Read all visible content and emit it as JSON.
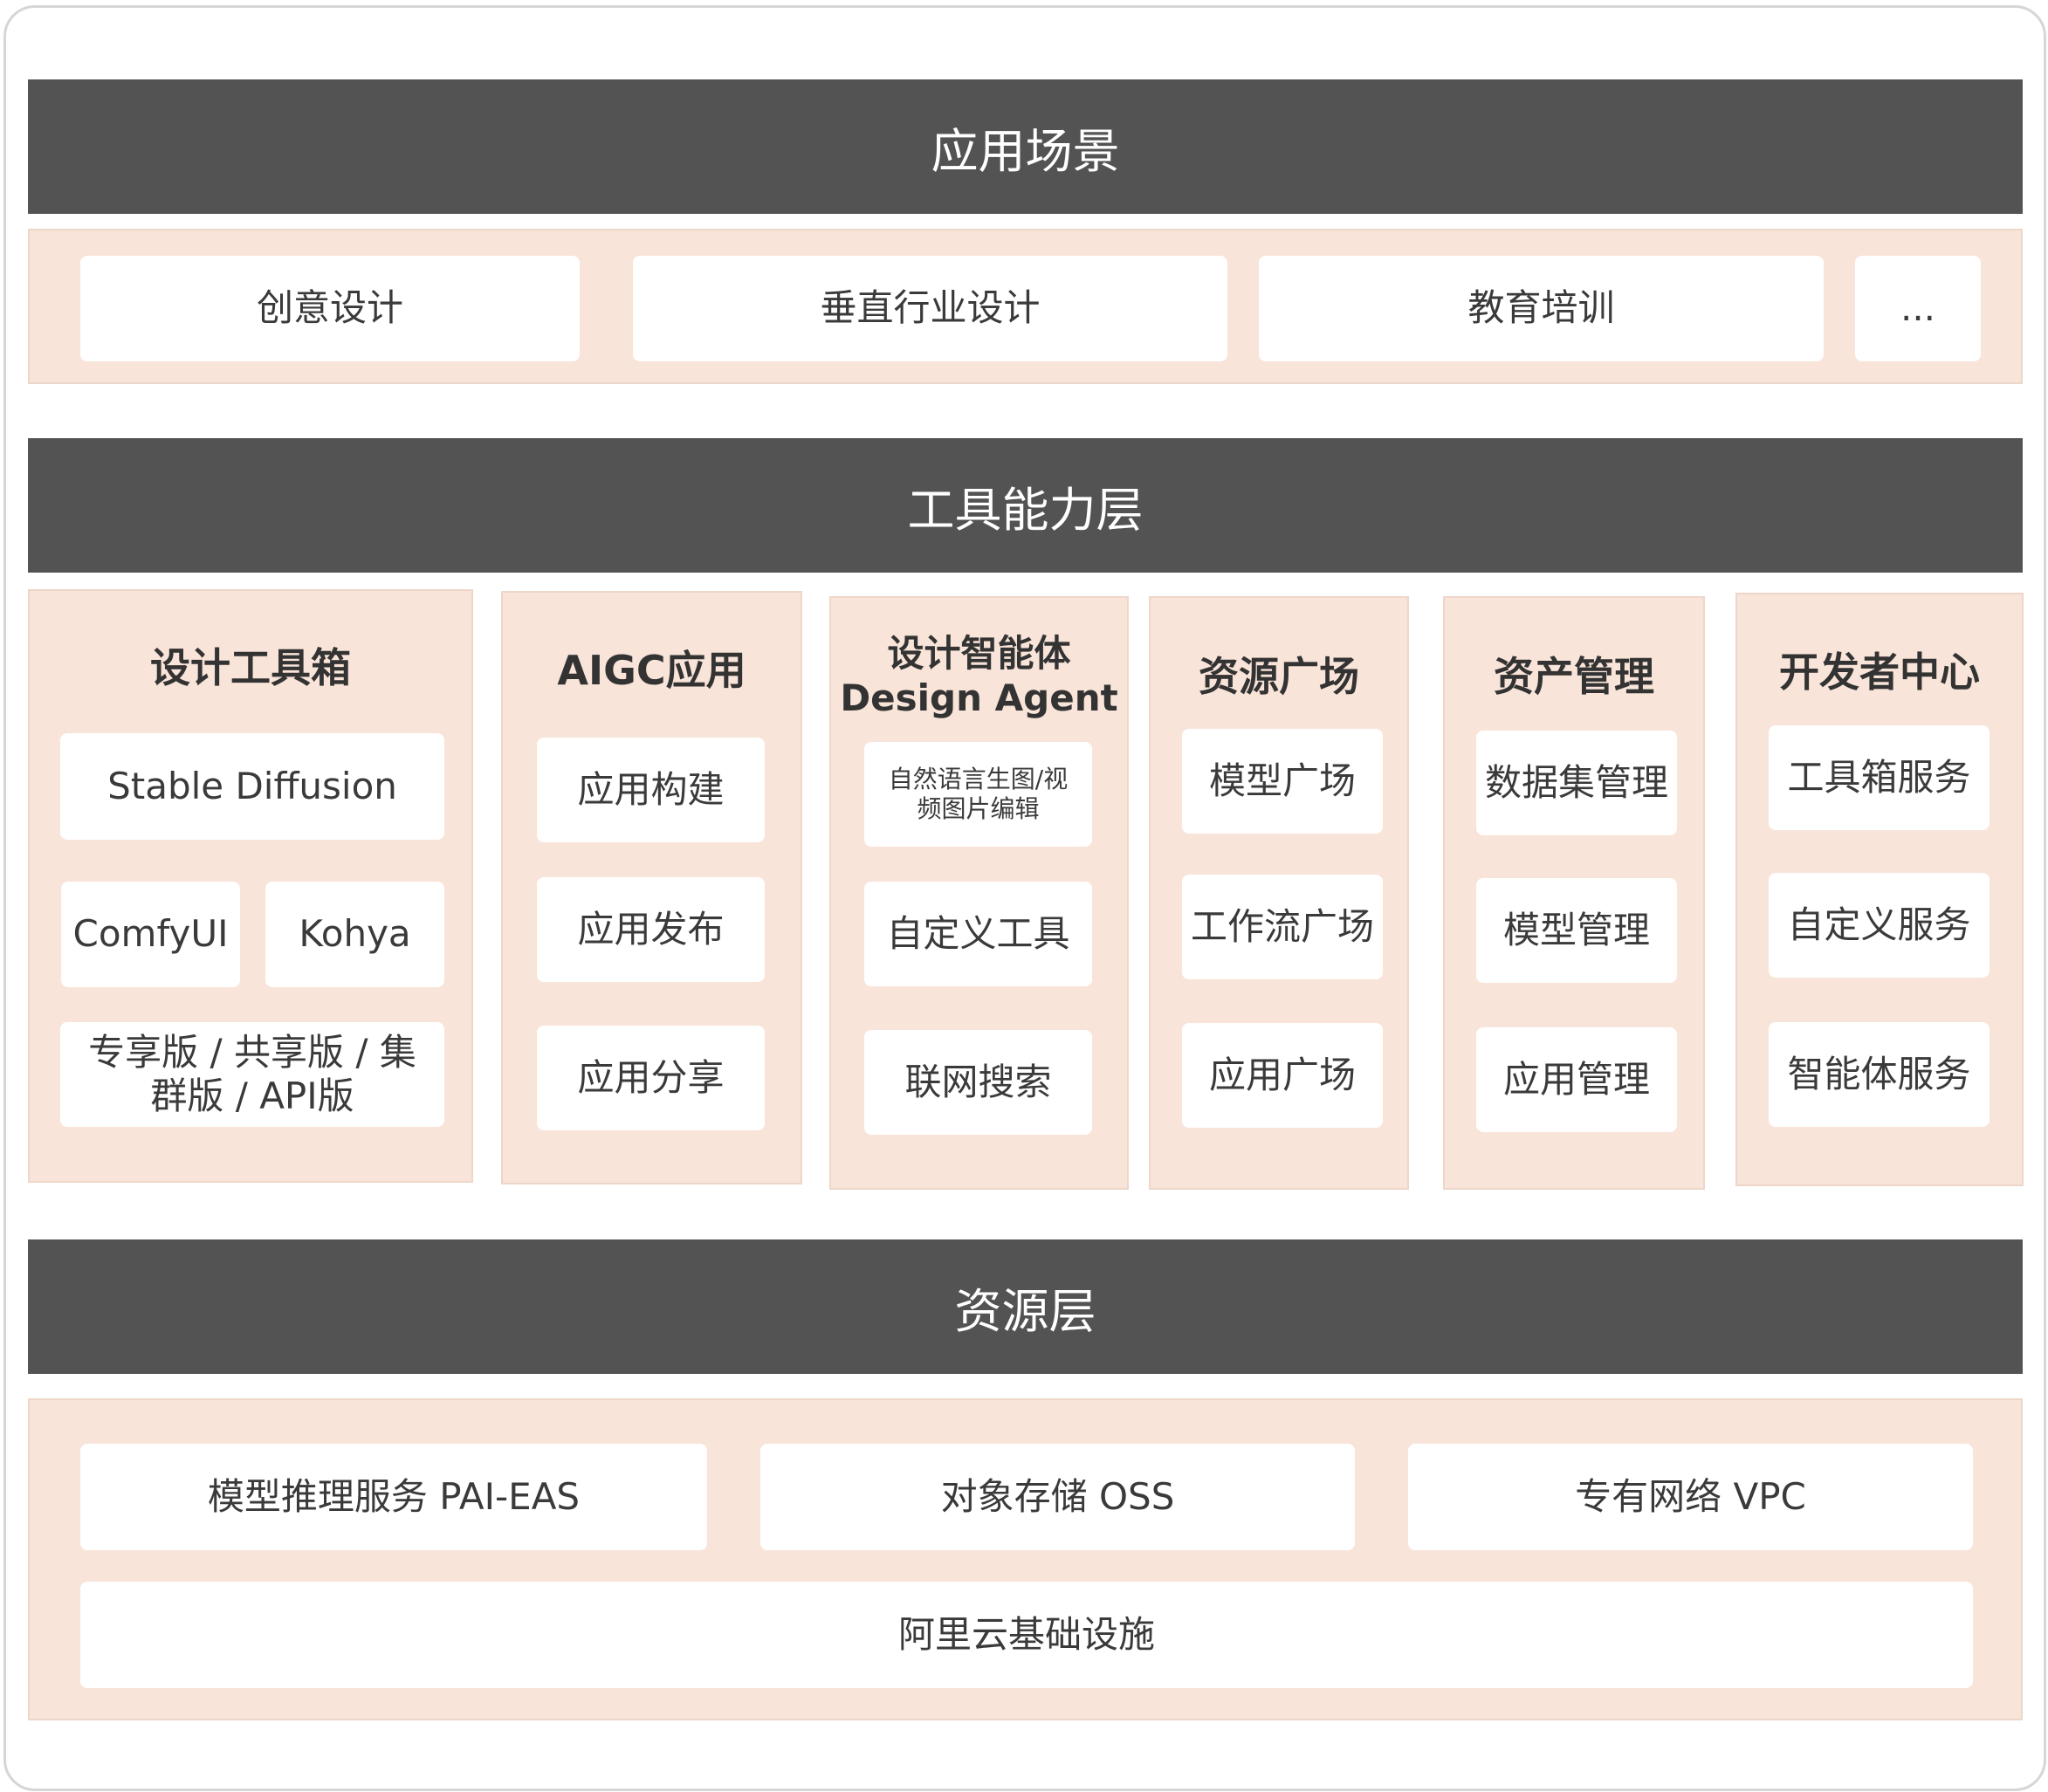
{
  "colors": {
    "header_bar": "#535353",
    "band_fill": "#f9e4d9",
    "box_fill": "#ffffff"
  },
  "sections": {
    "scenarios": {
      "title": "应用场景",
      "items": [
        "创意设计",
        "垂直行业设计",
        "教育培训",
        "..."
      ]
    },
    "tools": {
      "title": "工具能力层",
      "columns": [
        {
          "title": "设计工具箱",
          "items": [
            "Stable Diffusion",
            "ComfyUI",
            "Kohya",
            "专享版 / 共享版 / 集群版 / API版"
          ]
        },
        {
          "title": "AIGC应用",
          "items": [
            "应用构建",
            "应用发布",
            "应用分享"
          ]
        },
        {
          "title_line1": "设计智能体",
          "title_line2": "Design Agent",
          "items": [
            "自然语言生图/视频图片编辑",
            "自定义工具",
            "联网搜索"
          ]
        },
        {
          "title": "资源广场",
          "items": [
            "模型广场",
            "工作流广场",
            "应用广场"
          ]
        },
        {
          "title": "资产管理",
          "items": [
            "数据集管理",
            "模型管理",
            "应用管理"
          ]
        },
        {
          "title": "开发者中心",
          "items": [
            "工具箱服务",
            "自定义服务",
            "智能体服务"
          ]
        }
      ]
    },
    "resources": {
      "title": "资源层",
      "items": [
        "模型推理服务 PAI-EAS",
        "对象存储 OSS",
        "专有网络 VPC",
        "阿里云基础设施"
      ]
    }
  }
}
